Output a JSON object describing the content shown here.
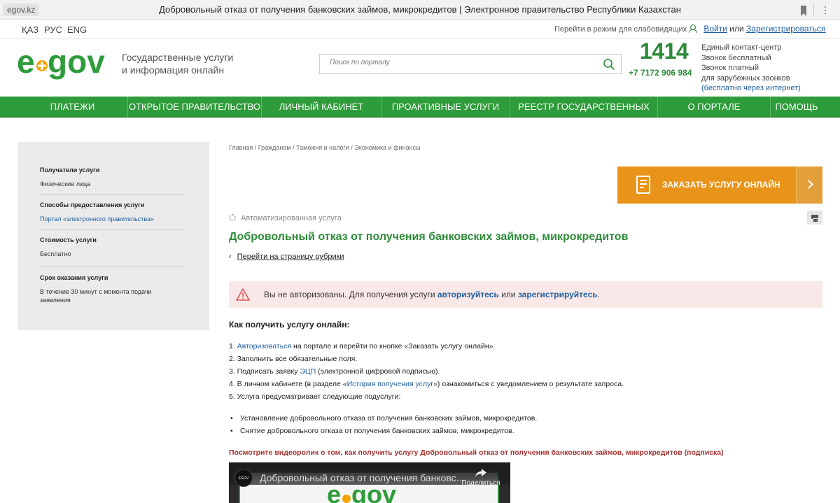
{
  "browser": {
    "url": "egov.kz",
    "title": "Добровольный отказ от получения банковских займов, микрокредитов | Электронное правительство Республики Казахстан"
  },
  "topbar": {
    "languages": [
      "ҚАЗ",
      "РУС",
      "ENG"
    ],
    "low_vision": "Перейти в режим для слабовидящих",
    "login": "Войти",
    "or": "или",
    "register": "Зарегистрироваться"
  },
  "header": {
    "tagline_line1": "Государственные услуги",
    "tagline_line2": "и информация онлайн",
    "search_placeholder": "Поиск по порталу",
    "contact_short": "1414",
    "contact_phone": "+7 7172 906 984",
    "contact_notes": [
      "Единый контакт-центр",
      "Звонок бесплатный",
      "Звонок платный",
      "для зарубежных звонков",
      "(бесплатно через интернет)"
    ]
  },
  "nav": [
    "ПЛАТЕЖИ",
    "ОТКРЫТОЕ ПРАВИТЕЛЬСТВО",
    "ЛИЧНЫЙ КАБИНЕТ",
    "ПРОАКТИВНЫЕ УСЛУГИ",
    "РЕЕСТР ГОСУДАРСТВЕННЫХ УСЛУГ",
    "О ПОРТАЛЕ",
    "ПОМОЩЬ"
  ],
  "sidebar": {
    "recipients_title": "Получатели услуги",
    "recipients_value": "Физические лица",
    "methods_title": "Способы предоставления услуги",
    "methods_value": "Портал «электронного правительства»",
    "cost_title": "Стоимость услуги",
    "cost_value": "Бесплатно",
    "term_title": "Срок оказания услуги",
    "term_value": "В течение 30 минут с момента подачи заявления"
  },
  "main": {
    "breadcrumb": "Главная / Гражданам / Таможня и налоги / Экономика и финансы",
    "order_button": "ЗАКАЗАТЬ УСЛУГУ ОНЛАЙН",
    "auto_service": "Автоматизированная услуга",
    "title": "Добровольный отказ от получения банковских займов, микрокредитов",
    "back_link": "Перейти на страницу рубрики",
    "alert_text": "Вы не авторизованы. Для получения услуги",
    "alert_login": "авторизуйтесь",
    "alert_or": "или",
    "alert_register": "зарегистрируйтесь",
    "alert_end": ".",
    "how_title": "Как получить услугу онлайн:",
    "step1_pre": "1. ",
    "step1_link": "Авторизоваться",
    "step1_post": " на портале и перейти по кнопке «Заказать услугу онлайн».",
    "step2": "2. Заполнить все обязательные поля.",
    "step3_pre": "3. Подписать заявку ",
    "step3_link": "ЭЦП",
    "step3_post": " (электронной цифровой подписью).",
    "step4_pre": "4. В личном кабинете (в разделе «",
    "step4_link": "История получения услуг",
    "step4_post": "») ознакомиться с уведомлением о результате запроса.",
    "step5": "5. Услуга предусматривает следующие подуслуги:",
    "bullet1": "Установление добровольного отказа от получения банковских займов, микрокредитов.",
    "bullet2": "Снятие добровольного отказа от получения банковских займов, микрокредитов.",
    "video_caption": "Посмотрите видеоролик о том, как получить услугу Добровольный отказ от получения банковских займов, микрокредитов (подписка)",
    "video_title": "Добровольный отказ от получения банковс...",
    "video_share": "Поделиться",
    "video_channel": "EGOV"
  },
  "colors": {
    "green": "#2e9c3a",
    "orange": "#e8941a",
    "link_blue": "#1f5f9f",
    "alert_bg": "#f9e8e8"
  }
}
